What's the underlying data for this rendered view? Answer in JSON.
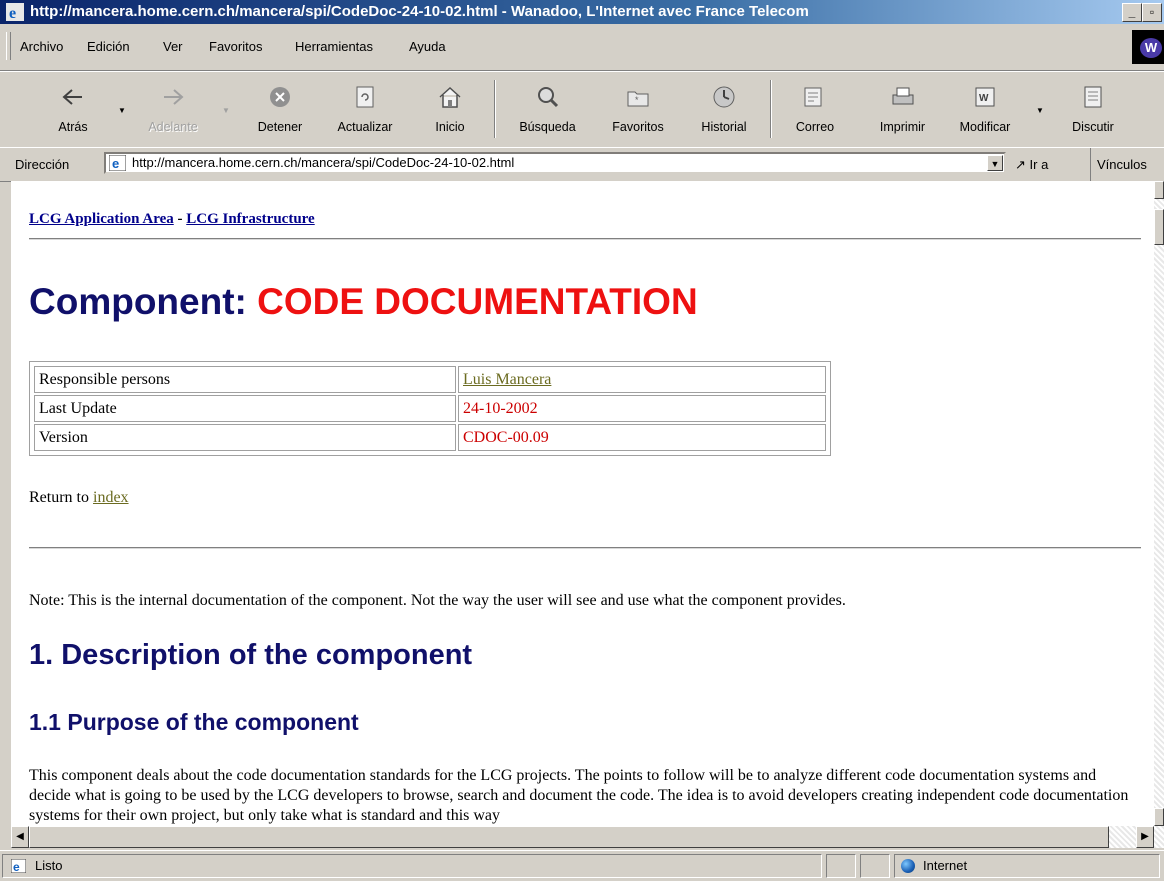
{
  "window": {
    "title": "http://mancera.home.cern.ch/mancera/spi/CodeDoc-24-10-02.html - Wanadoo, L'Internet avec France Telecom"
  },
  "menu": {
    "items": [
      "Archivo",
      "Edición",
      "Ver",
      "Favoritos",
      "Herramientas",
      "Ayuda"
    ]
  },
  "toolbar": {
    "back": "Atrás",
    "forward": "Adelante",
    "stop": "Detener",
    "refresh": "Actualizar",
    "home": "Inicio",
    "search": "Búsqueda",
    "favorites": "Favoritos",
    "history": "Historial",
    "mail": "Correo",
    "print": "Imprimir",
    "edit": "Modificar",
    "discuss": "Discutir"
  },
  "address": {
    "label": "Dirección",
    "url": "http://mancera.home.cern.ch/mancera/spi/CodeDoc-24-10-02.html",
    "go": "Ir a",
    "links": "Vínculos"
  },
  "page": {
    "nav": {
      "link1": "LCG Application Area",
      "sep": "-",
      "link2": "LCG Infrastructure"
    },
    "title_prefix": "Component: ",
    "title_name": "CODE DOCUMENTATION",
    "info": [
      {
        "key": "Responsible persons",
        "value": "Luis Mancera"
      },
      {
        "key": "Last Update",
        "value": "24-10-2002"
      },
      {
        "key": "Version",
        "value": "CDOC-00.09"
      }
    ],
    "return_text": "Return to",
    "return_link": "index",
    "note": "Note: This is the internal documentation of the component. Not the way the user will see and use what the component provides.",
    "section1": "1. Description of the component",
    "section1_1": "1.1 Purpose of the component",
    "paragraph": "This component deals about the code documentation standards for the LCG projects. The points to follow will be to analyze different code documentation systems and decide what is going to be used by the LCG developers to browse, search and document the code. The idea is to avoid developers creating independent code documentation systems for their own project, but only take what is standard and this way"
  },
  "status": {
    "text": "Listo",
    "zone": "Internet"
  },
  "brand_logo": "W"
}
